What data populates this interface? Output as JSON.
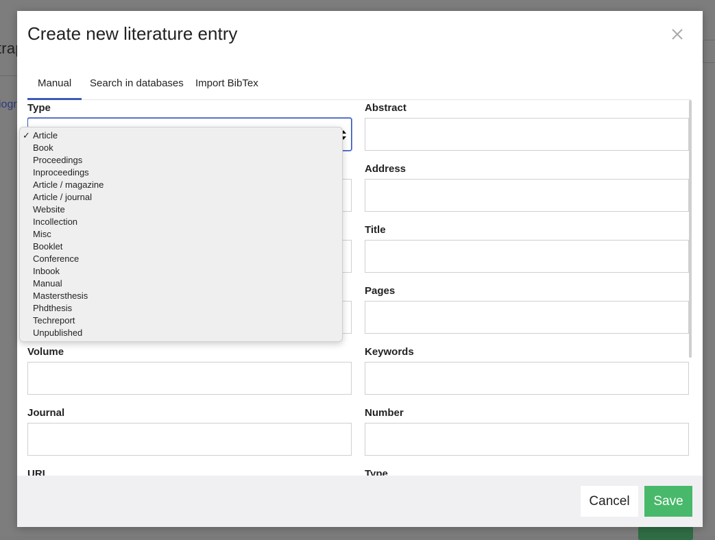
{
  "background": {
    "partial_heading": "trap",
    "partial_link": "iogr"
  },
  "modal": {
    "title": "Create new literature entry",
    "close_icon": "close-icon"
  },
  "tabs": [
    {
      "label": "Manual",
      "active": true
    },
    {
      "label": "Search in databases",
      "active": false
    },
    {
      "label": "Import BibTex",
      "active": false
    }
  ],
  "fields": {
    "type": {
      "label": "Type",
      "value": "Article"
    },
    "abstract": {
      "label": "Abstract",
      "value": ""
    },
    "address": {
      "label": "Address",
      "value": ""
    },
    "title": {
      "label": "Title",
      "value": ""
    },
    "pages": {
      "label": "Pages",
      "value": ""
    },
    "volume": {
      "label": "Volume",
      "value": ""
    },
    "keywords": {
      "label": "Keywords",
      "value": ""
    },
    "journal": {
      "label": "Journal",
      "value": ""
    },
    "number": {
      "label": "Number",
      "value": ""
    },
    "url": {
      "label": "URL"
    },
    "type2": {
      "label": "Type"
    }
  },
  "type_options": [
    {
      "label": "Article",
      "selected": true
    },
    {
      "label": "Book"
    },
    {
      "label": "Proceedings"
    },
    {
      "label": "Inproceedings"
    },
    {
      "label": "Article / magazine"
    },
    {
      "label": "Article / journal"
    },
    {
      "label": "Website"
    },
    {
      "label": "Incollection"
    },
    {
      "label": "Misc"
    },
    {
      "label": "Booklet"
    },
    {
      "label": "Conference"
    },
    {
      "label": "Inbook"
    },
    {
      "label": "Manual"
    },
    {
      "label": "Mastersthesis"
    },
    {
      "label": "Phdthesis"
    },
    {
      "label": "Techreport"
    },
    {
      "label": "Unpublished"
    }
  ],
  "footer": {
    "cancel_label": "Cancel",
    "save_label": "Save"
  },
  "colors": {
    "accent": "#3b5bb7",
    "save": "#48b96a",
    "footer_bg": "#f0f0f3"
  }
}
